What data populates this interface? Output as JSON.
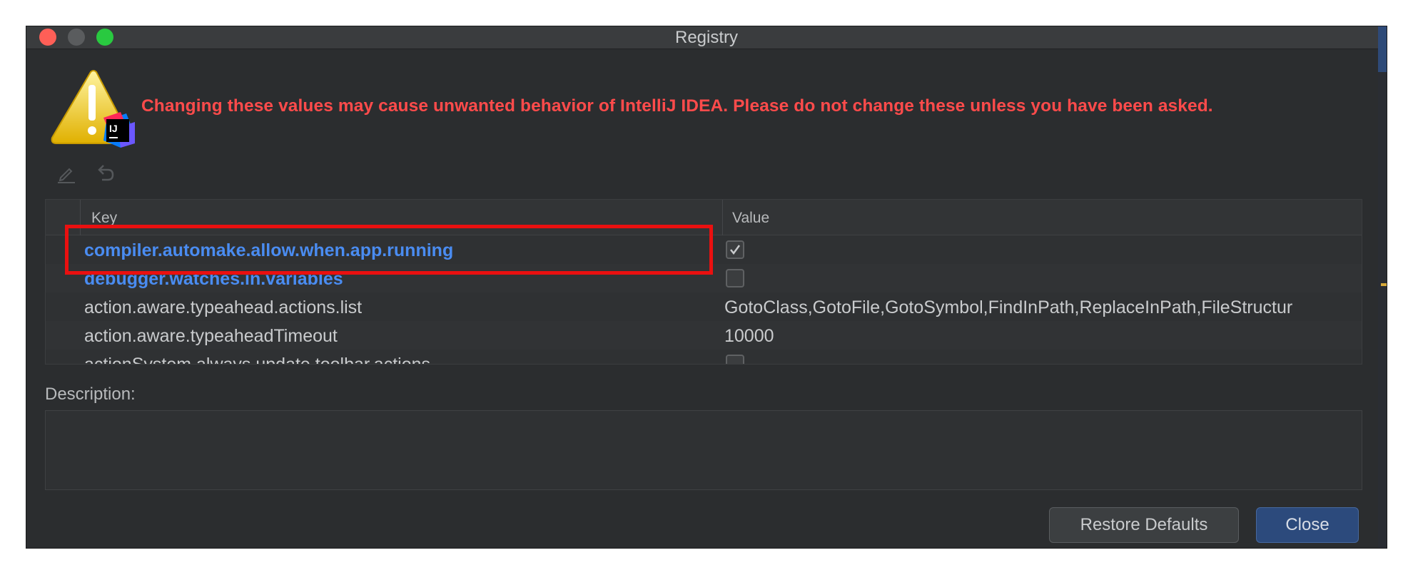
{
  "window": {
    "title": "Registry"
  },
  "warning": {
    "message": "Changing these values may cause unwanted behavior of IntelliJ IDEA. Please do not change these unless you have been asked.",
    "icon": "warning-ij-icon",
    "badge_text": "IJ"
  },
  "toolbar": {
    "edit_icon": "pencil-icon",
    "undo_icon": "undo-icon"
  },
  "table": {
    "columns": {
      "key": "Key",
      "value": "Value"
    },
    "rows": [
      {
        "key": "compiler.automake.allow.when.app.running",
        "type": "checkbox",
        "checked": true,
        "modified": true
      },
      {
        "key": "debugger.watches.in.variables",
        "type": "checkbox",
        "checked": false,
        "modified": true
      },
      {
        "key": "action.aware.typeahead.actions.list",
        "type": "text",
        "value": "GotoClass,GotoFile,GotoSymbol,FindInPath,ReplaceInPath,FileStructur",
        "modified": false
      },
      {
        "key": "action.aware.typeaheadTimeout",
        "type": "text",
        "value": "10000",
        "modified": false
      },
      {
        "key": "actionSystem.always.update.toolbar.actions",
        "type": "checkbox",
        "checked": false,
        "modified": false
      }
    ]
  },
  "description": {
    "label": "Description:",
    "text": ""
  },
  "buttons": {
    "restore_defaults": "Restore Defaults",
    "close": "Close"
  },
  "colors": {
    "warning_text": "#ff4b4b",
    "modified_key": "#4a8cf1",
    "highlight_box": "#ea1010",
    "primary_button": "#2c4a7c"
  }
}
